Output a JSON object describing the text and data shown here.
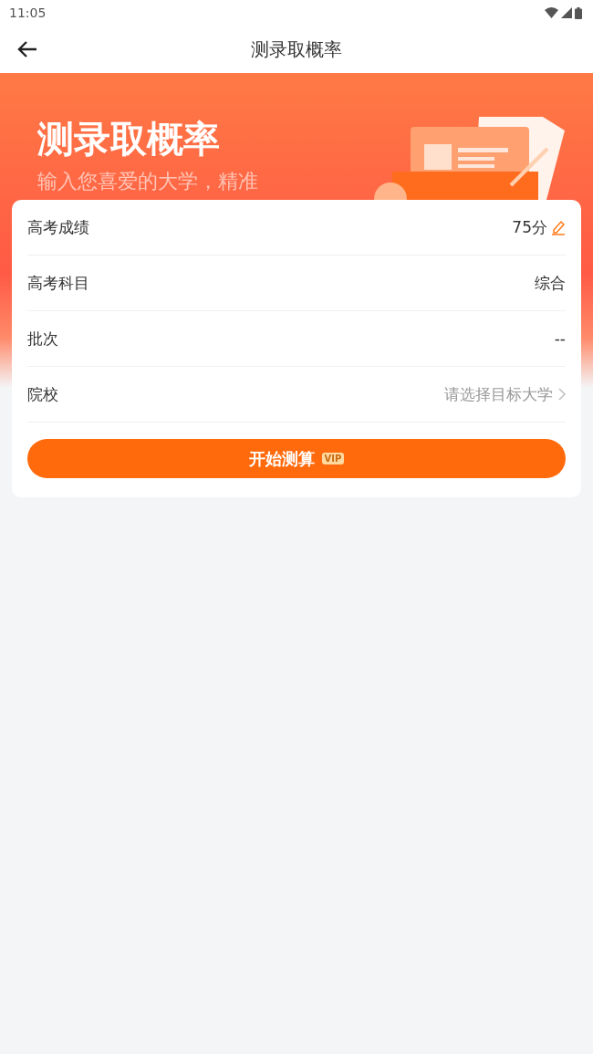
{
  "status_bar": {
    "time": "11:05"
  },
  "nav": {
    "title": "测录取概率"
  },
  "banner": {
    "title": "测录取概率",
    "subtitle": "输入您喜爱的大学，精准"
  },
  "form": {
    "rows": [
      {
        "label": "高考成绩",
        "value": "75分",
        "kind": "editable"
      },
      {
        "label": "高考科目",
        "value": "综合",
        "kind": "plain"
      },
      {
        "label": "批次",
        "value": "--",
        "kind": "plain"
      },
      {
        "label": "院校",
        "placeholder": "请选择目标大学",
        "kind": "select"
      }
    ],
    "submit": {
      "label": "开始测算",
      "badge": "VIP"
    }
  }
}
